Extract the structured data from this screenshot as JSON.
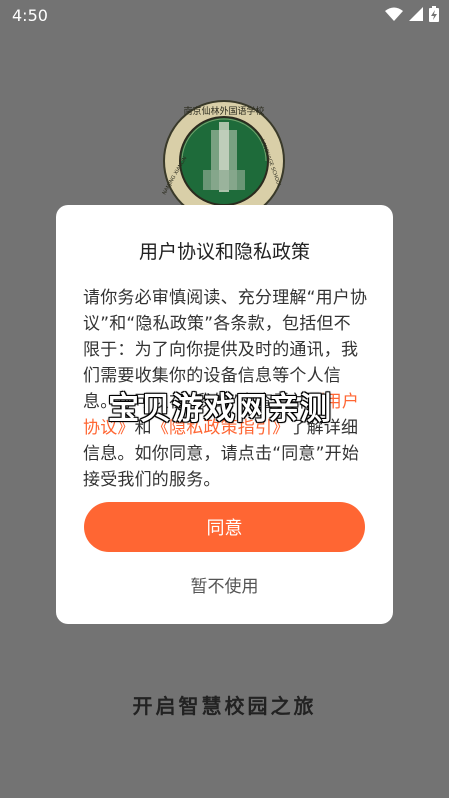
{
  "status_bar": {
    "time": "4:50"
  },
  "logo": {
    "text_top": "南京仙林外国语学校",
    "text_side": "NANJING XIANLIN",
    "text_right": "LANGUAGE SCHOOL"
  },
  "dialog": {
    "title": "用户协议和隐私政策",
    "body_part1": "请你务必审慎阅读、充分理解“用户协议”和“隐私政策”各条款，包括但不限于：为了向你提供及时的通讯，我们需要收集你的设备信息等个人信息。你可以在“我的”中查看并",
    "link_user_agreement": "《用户协议》",
    "body_and": "和",
    "link_privacy_guide": "《隐私政策指引》",
    "body_part2": "了解详细信息。如你同意，请点击“同意”开始接受我们的服务。",
    "agree_label": "同意",
    "decline_label": "暂不使用"
  },
  "watermark": "宝贝游戏网亲测",
  "slogan": "开启智慧校园之旅",
  "colors": {
    "accent": "#ff6633",
    "backdrop": "#737373",
    "logo_green": "#1e6b3a"
  }
}
